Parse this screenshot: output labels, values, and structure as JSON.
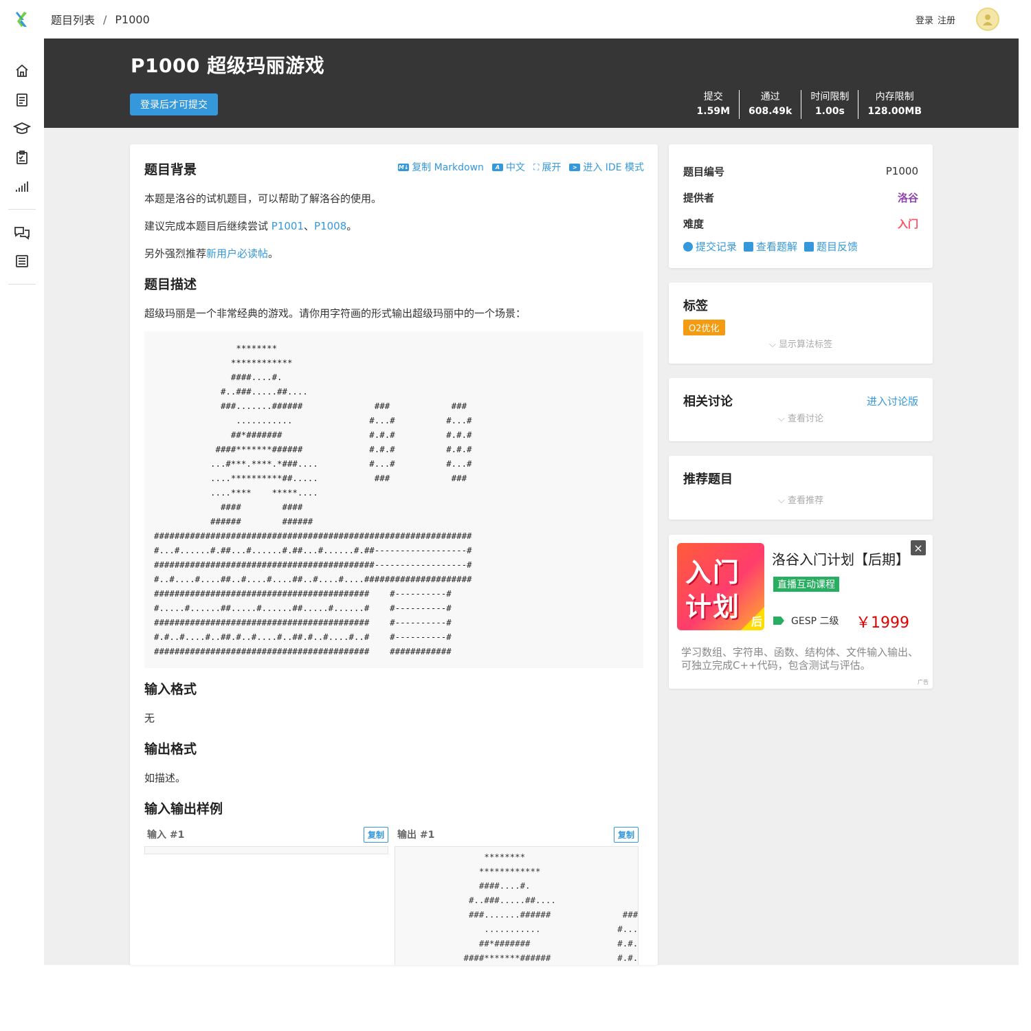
{
  "breadcrumb": {
    "list": "题目列表",
    "sep": "/",
    "current": "P1000"
  },
  "auth": {
    "login": "登录",
    "register": "注册"
  },
  "header": {
    "title": "P1000 超级玛丽游戏",
    "submit_label": "登录后才可提交",
    "stats": [
      {
        "name": "提交",
        "value": "1.59M"
      },
      {
        "name": "通过",
        "value": "608.49k"
      },
      {
        "name": "时间限制",
        "value": "1.00s"
      },
      {
        "name": "内存限制",
        "value": "128.00MB"
      }
    ]
  },
  "toolbar": {
    "copy_md": "复制 Markdown",
    "lang": "中文",
    "expand": "展开",
    "ide": "进入 IDE 模式"
  },
  "problem": {
    "bg_title": "题目背景",
    "bg_p1": "本题是洛谷的试机题目，可以帮助了解洛谷的使用。",
    "bg_p2_pre": "建议完成本题目后继续尝试 ",
    "bg_link1": "P1001",
    "bg_p2_mid": "、",
    "bg_link2": "P1008",
    "bg_p2_end": "。",
    "bg_p3_pre": "另外强烈推荐",
    "bg_link3": "新用户必读帖",
    "bg_p3_end": "。",
    "desc_title": "题目描述",
    "desc_p": "超级玛丽是一个非常经典的游戏。请你用字符画的形式输出超级玛丽中的一个场景：",
    "art": "                ********\n               ************\n               ####....#.\n             #..###.....##....\n             ###.......######              ###            ###\n                ...........               #...#          #...#\n               ##*#######                 #.#.#          #.#.#\n            ####*******######             #.#.#          #.#.#\n           ...#***.****.*###....          #...#          #...#\n           ....**********##.....           ###            ###\n           ....****    *****....\n             ####        ####\n           ######        ######\n##############################################################\n#...#......#.##...#......#.##...#......#.##------------------#\n###########################################------------------#\n#..#....#....##..#....#....##..#....#....#####################\n##########################################    #----------#\n#.....#......##.....#......##.....#......#    #----------#\n##########################################    #----------#\n#.#..#....#..##.#..#....#..##.#..#....#..#    #----------#\n##########################################    ############",
    "input_title": "输入格式",
    "input_p": "无",
    "output_title": "输出格式",
    "output_p": "如描述。",
    "samples_title": "输入输出样例",
    "sample_in_label": "输入 #1",
    "sample_out_label": "输出 #1",
    "copy_label": "复制",
    "sample_in": "",
    "sample_out": "                ********\n               ************\n               ####....#.\n             #..###.....##....\n             ###.......######              ###\n                ...........               #...#\n               ##*#######                 #.#.#\n            ####*******######             #.#.#\n           ...#***.****.*###....          #...#"
  },
  "info": {
    "id_label": "题目编号",
    "id_value": "P1000",
    "provider_label": "提供者",
    "provider_value": "洛谷",
    "provider_color": "#8e44ad",
    "difficulty_label": "难度",
    "difficulty_value": "入门",
    "difficulty_color": "#fe4c61",
    "links": [
      "提交记录",
      "查看题解",
      "题目反馈"
    ]
  },
  "tags": {
    "title": "标签",
    "badge": "O2优化",
    "toggle": "显示算法标签"
  },
  "discussion": {
    "title": "相关讨论",
    "link": "进入讨论版",
    "toggle": "查看讨论"
  },
  "recommend": {
    "title": "推荐题目",
    "toggle": "查看推荐"
  },
  "ad": {
    "img_line1": "入门",
    "img_line2": "计划",
    "img_corner": "后",
    "title": "洛谷入门计划【后期】",
    "badge": "直播互动课程",
    "gesp": "GESP 二级",
    "price": "￥1999",
    "desc": "学习数组、字符串、函数、结构体、文件输入输出、可独立完成C++代码，包含测试与评估。",
    "mini": "广告",
    "close": "×"
  },
  "colors": {
    "accent": "#3498db",
    "header_bg": "#363636",
    "tag_orange": "#f39c11"
  }
}
